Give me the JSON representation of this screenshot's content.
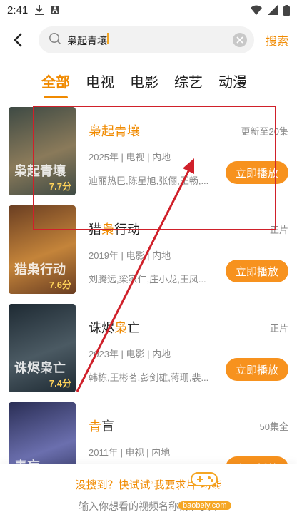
{
  "status_bar": {
    "time": "2:41",
    "icons": [
      "download-icon",
      "a-notification-icon",
      "wifi-icon",
      "signal-icon",
      "battery-icon"
    ]
  },
  "search": {
    "query": "枭起青壤",
    "button_label": "搜索"
  },
  "tabs": [
    {
      "label": "全部",
      "active": true
    },
    {
      "label": "电视",
      "active": false
    },
    {
      "label": "电影",
      "active": false
    },
    {
      "label": "综艺",
      "active": false
    },
    {
      "label": "动漫",
      "active": false
    }
  ],
  "results": [
    {
      "title_parts": [
        {
          "text": "枭起青壤",
          "hl": true
        }
      ],
      "status": "更新至20集",
      "meta": "2025年 | 电视 | 内地",
      "cast": "迪丽热巴,陈星旭,张俪,王畅,...",
      "score": "7.7分",
      "poster_text": "枭起青壤",
      "play_label": "立即播放",
      "poster_colors": [
        "#3e4a44",
        "#8a7a5a"
      ]
    },
    {
      "title_parts": [
        {
          "text": "猎",
          "hl": false
        },
        {
          "text": "枭",
          "hl": true
        },
        {
          "text": "行动",
          "hl": false
        }
      ],
      "status": "正片",
      "meta": "2019年 | 电影 | 内地",
      "cast": "刘腾远,梁家仁,庄小龙,王凤...",
      "score": "7.6分",
      "poster_text": "猎枭行动",
      "play_label": "立即播放",
      "poster_colors": [
        "#6a3e22",
        "#c4843a"
      ]
    },
    {
      "title_parts": [
        {
          "text": "诛烬",
          "hl": false
        },
        {
          "text": "枭",
          "hl": true
        },
        {
          "text": "亡",
          "hl": false
        }
      ],
      "status": "正片",
      "meta": "2023年 | 电影 | 内地",
      "cast": "韩栋,王彬茗,彭剑雄,蒋珊,裴...",
      "score": "7.4分",
      "poster_text": "诛烬枭亡",
      "play_label": "立即播放",
      "poster_colors": [
        "#1e2a33",
        "#4b5a63"
      ]
    },
    {
      "title_parts": [
        {
          "text": "青",
          "hl": true
        },
        {
          "text": "盲",
          "hl": false
        }
      ],
      "status": "50集全",
      "meta": "2011年 | 电视 | 内地",
      "cast": "",
      "score": "",
      "poster_text": "青盲",
      "play_label": "立即播放",
      "poster_colors": [
        "#2a2e55",
        "#6b6fae"
      ]
    }
  ],
  "footer": {
    "line1": "没搜到？快试试“我要求片”功能",
    "line2": "输入你想看的视频名称精准求片"
  },
  "watermark": {
    "text": "宝贝游戏网",
    "url": "baobeiy.com"
  },
  "colors": {
    "accent": "#f08a00",
    "play_button": "#f7921e",
    "annotation_red": "#d0202a"
  }
}
